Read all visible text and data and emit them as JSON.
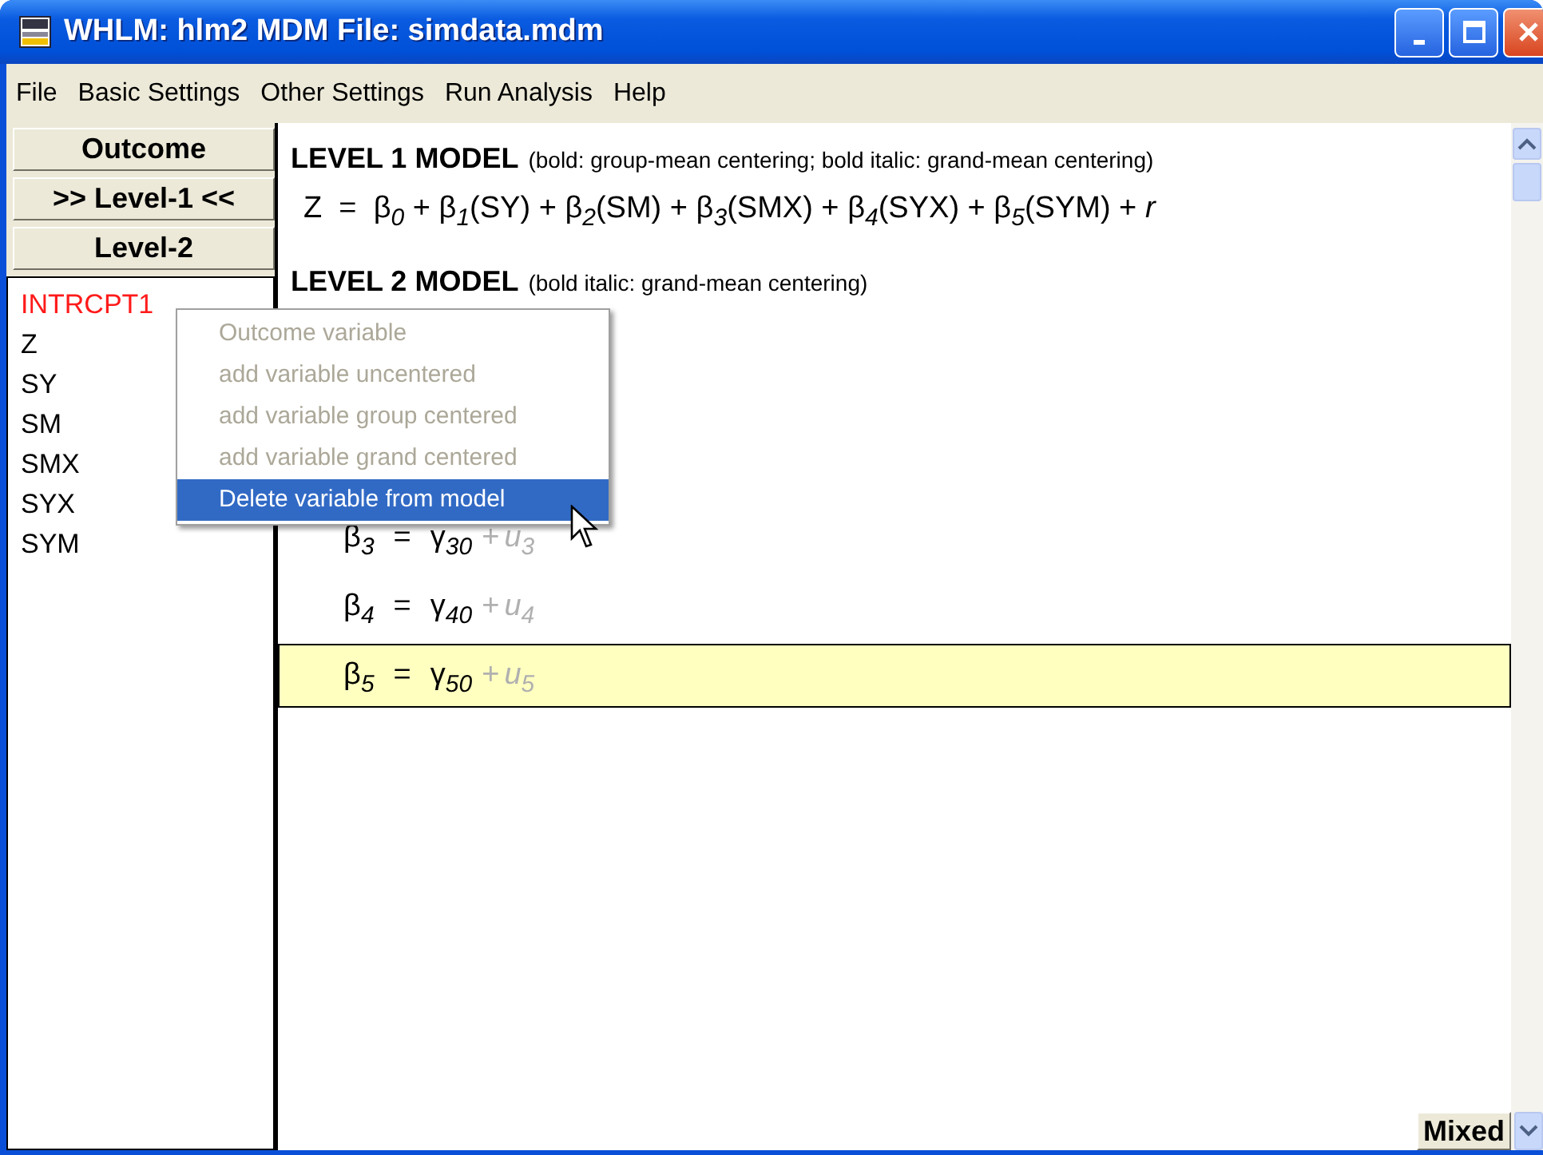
{
  "window": {
    "title": "WHLM: hlm2 MDM File: simdata.mdm"
  },
  "menu_bar": [
    "File",
    "Basic Settings",
    "Other Settings",
    "Run Analysis",
    "Help"
  ],
  "nav_buttons": [
    "Outcome",
    ">> Level-1 <<",
    "Level-2"
  ],
  "variables": [
    {
      "name": "INTRCPT1",
      "selected": true
    },
    {
      "name": "Z",
      "selected": false
    },
    {
      "name": "SY",
      "selected": false
    },
    {
      "name": "SM",
      "selected": false
    },
    {
      "name": "SMX",
      "selected": false
    },
    {
      "name": "SYX",
      "selected": false
    },
    {
      "name": "SYM",
      "selected": false
    }
  ],
  "level1": {
    "heading": "LEVEL 1 MODEL",
    "note": "(bold: group-mean centering; bold italic: grand-mean centering)",
    "equation": [
      {
        "kind": "plain",
        "text": "Z  =  "
      },
      {
        "kind": "coef",
        "symbol": "β",
        "sub": "0"
      },
      {
        "kind": "plain",
        "text": " + "
      },
      {
        "kind": "coef",
        "symbol": "β",
        "sub": "1"
      },
      {
        "kind": "plain",
        "text": "(SY) + "
      },
      {
        "kind": "coef",
        "symbol": "β",
        "sub": "2"
      },
      {
        "kind": "plain",
        "text": "(SM) + "
      },
      {
        "kind": "coef",
        "symbol": "β",
        "sub": "3"
      },
      {
        "kind": "plain",
        "text": "(SMX) + "
      },
      {
        "kind": "coef",
        "symbol": "β",
        "sub": "4"
      },
      {
        "kind": "plain",
        "text": "(SYX) + "
      },
      {
        "kind": "coef",
        "symbol": "β",
        "sub": "5"
      },
      {
        "kind": "plain",
        "text": "(SYM) + "
      },
      {
        "kind": "italic",
        "text": "r"
      }
    ]
  },
  "level2": {
    "heading": "LEVEL 2 MODEL",
    "note": "(bold italic: grand-mean centering)",
    "rows": [
      {
        "beta": "β",
        "beta_sub": "3",
        "equals": "=",
        "gamma": "γ",
        "gamma_sub": "30",
        "plus": "+",
        "u": "u",
        "u_sub": "3",
        "random": false,
        "selected": false
      },
      {
        "beta": "β",
        "beta_sub": "4",
        "equals": "=",
        "gamma": "γ",
        "gamma_sub": "40",
        "plus": "+",
        "u": "u",
        "u_sub": "4",
        "random": false,
        "selected": false
      },
      {
        "beta": "β",
        "beta_sub": "5",
        "equals": "=",
        "gamma": "γ",
        "gamma_sub": "50",
        "plus": "+",
        "u": "u",
        "u_sub": "5",
        "random": false,
        "selected": true
      }
    ]
  },
  "context_menu": [
    {
      "label": "Outcome variable",
      "disabled": true,
      "selected": false
    },
    {
      "label": "add variable uncentered",
      "disabled": true,
      "selected": false
    },
    {
      "label": "add variable group centered",
      "disabled": true,
      "selected": false
    },
    {
      "label": "add variable grand centered",
      "disabled": true,
      "selected": false
    },
    {
      "label": "Delete variable from model",
      "disabled": false,
      "selected": true
    }
  ],
  "mixed_button": "Mixed"
}
